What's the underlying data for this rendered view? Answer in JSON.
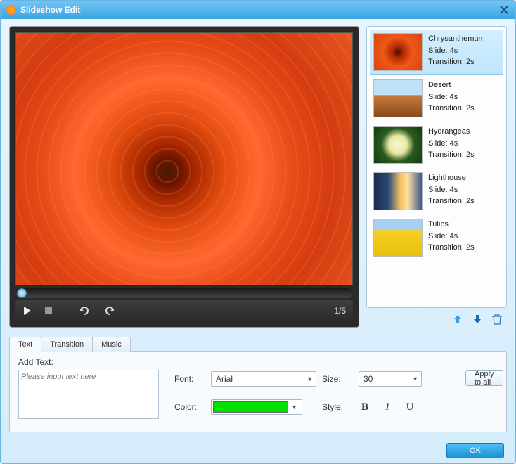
{
  "title": "Slideshow Edit",
  "preview": {
    "counter": "1/5"
  },
  "slides": [
    {
      "name": "Chrysanthemum",
      "slide_label": "Slide: 4s",
      "transition_label": "Transition: 2s",
      "thumb_class": "ti-chrys",
      "selected": true
    },
    {
      "name": "Desert",
      "slide_label": "Slide: 4s",
      "transition_label": "Transition: 2s",
      "thumb_class": "ti-desert",
      "selected": false
    },
    {
      "name": "Hydrangeas",
      "slide_label": "Slide: 4s",
      "transition_label": "Transition: 2s",
      "thumb_class": "ti-hydra",
      "selected": false
    },
    {
      "name": "Lighthouse",
      "slide_label": "Slide: 4s",
      "transition_label": "Transition: 2s",
      "thumb_class": "ti-light",
      "selected": false
    },
    {
      "name": "Tulips",
      "slide_label": "Slide: 4s",
      "transition_label": "Transition: 2s",
      "thumb_class": "ti-tulip",
      "selected": false
    }
  ],
  "tabs": {
    "text": "Text",
    "transition": "Transition",
    "music": "Music",
    "active": "text"
  },
  "text_panel": {
    "add_text_label": "Add Text:",
    "placeholder": "Please input text here",
    "font_label": "Font:",
    "font_value": "Arial",
    "size_label": "Size:",
    "size_value": "30",
    "color_label": "Color:",
    "color_value": "#00E000",
    "style_label": "Style:",
    "bold": "B",
    "italic": "I",
    "underline": "U",
    "apply_all": "Apply to all"
  },
  "footer": {
    "ok": "OK"
  }
}
